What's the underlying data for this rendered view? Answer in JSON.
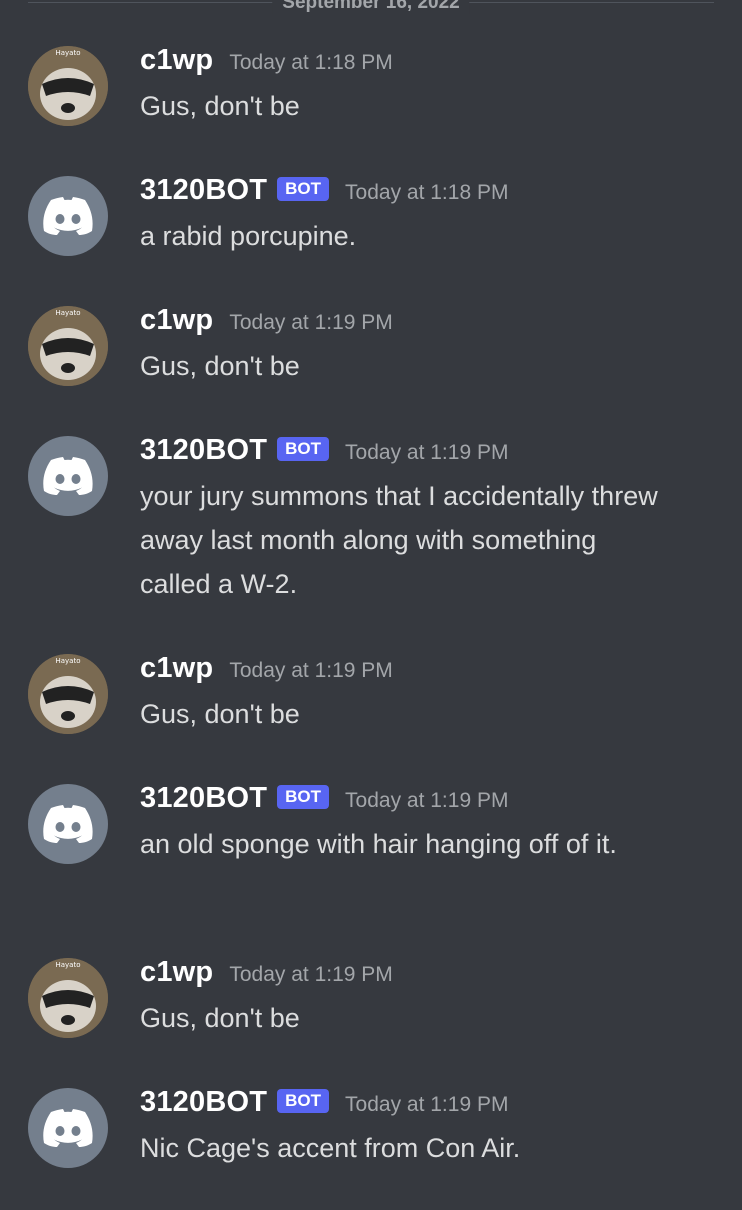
{
  "divider": {
    "date": "September 16, 2022"
  },
  "messages": [
    {
      "author": "c1wp",
      "time": "Today at 1:18 PM",
      "text": "Gus, don't be",
      "bot": false,
      "avatar_text": "Hayato"
    },
    {
      "author": "3120BOT",
      "badge": "BOT",
      "time": "Today at 1:18 PM",
      "text": "a rabid porcupine.",
      "bot": true
    },
    {
      "author": "c1wp",
      "time": "Today at 1:19 PM",
      "text": "Gus, don't be",
      "bot": false,
      "avatar_text": "Hayato"
    },
    {
      "author": "3120BOT",
      "badge": "BOT",
      "time": "Today at 1:19 PM",
      "text": "your jury summons that I accidentally threw away last month along with something called a W-2.",
      "bot": true
    },
    {
      "author": "c1wp",
      "time": "Today at 1:19 PM",
      "text": "Gus, don't be",
      "bot": false,
      "avatar_text": "Hayato"
    },
    {
      "author": "3120BOT",
      "badge": "BOT",
      "time": "Today at 1:19 PM",
      "text": "an old sponge with hair hanging off of it.",
      "bot": true
    },
    {
      "author": "c1wp",
      "time": "Today at 1:19 PM",
      "text": "Gus, don't be",
      "bot": false,
      "avatar_text": "Hayato"
    },
    {
      "author": "3120BOT",
      "badge": "BOT",
      "time": "Today at 1:19 PM",
      "text": "Nic Cage's accent from Con Air.",
      "bot": true
    }
  ],
  "icons": {
    "bot_avatar": "discord-logo-icon",
    "user_avatar": "raccoon-avatar"
  },
  "colors": {
    "background": "#36393f",
    "badge": "#5865f2",
    "bot_avatar_bg": "#747f8d"
  }
}
